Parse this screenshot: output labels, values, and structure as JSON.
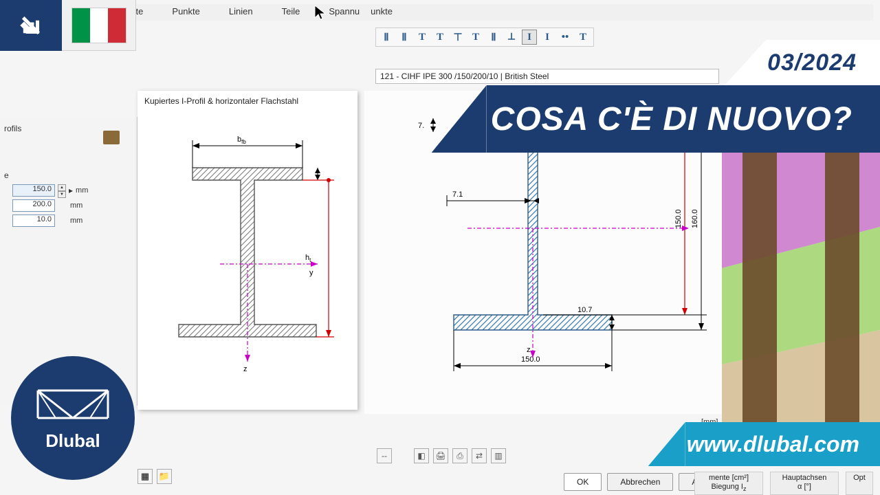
{
  "menu": {
    "m1": "erte",
    "m2": "Punkte",
    "m3": "Linien",
    "m4": "Teile",
    "m5": "Spannu",
    "m6": "unkte"
  },
  "overlay": {
    "date": "03/2024",
    "headline": "COSA C'È DI NUOVO?",
    "url": "www.dlubal.com",
    "logo_text": "Dlubal"
  },
  "section": {
    "description": "121 - CIHF IPE 300 /150/200/10 | British Steel",
    "card_title": "Kupiertes I-Profil & horizontaler Flachstahl",
    "labels": {
      "b": "b",
      "bf": "fb",
      "h": "h",
      "ht": "t",
      "y": "y",
      "z": "z"
    },
    "dims": {
      "web_t": "7.1",
      "flange_t": "10.7",
      "width": "150.0",
      "h1": "150.0",
      "h2": "160.0",
      "top_small": "7."
    },
    "unit_caption": "[mm]"
  },
  "params": {
    "heading": "rofils",
    "label_e": "e",
    "v1": "150.0",
    "v2": "200.0",
    "v3": "10.0",
    "unit": "mm",
    "spin_indicator": "▸"
  },
  "buttons": {
    "ok": "OK",
    "cancel": "Abbrechen",
    "apply": "Anwenden"
  },
  "cols": {
    "c1a": "mente [cm²]",
    "c1b": "Biegung I",
    "c2a": "Hauptachsen",
    "c2b": "α [°]",
    "c1sub": "z",
    "c3": "Opt"
  },
  "icons": {
    "dash": "--"
  }
}
